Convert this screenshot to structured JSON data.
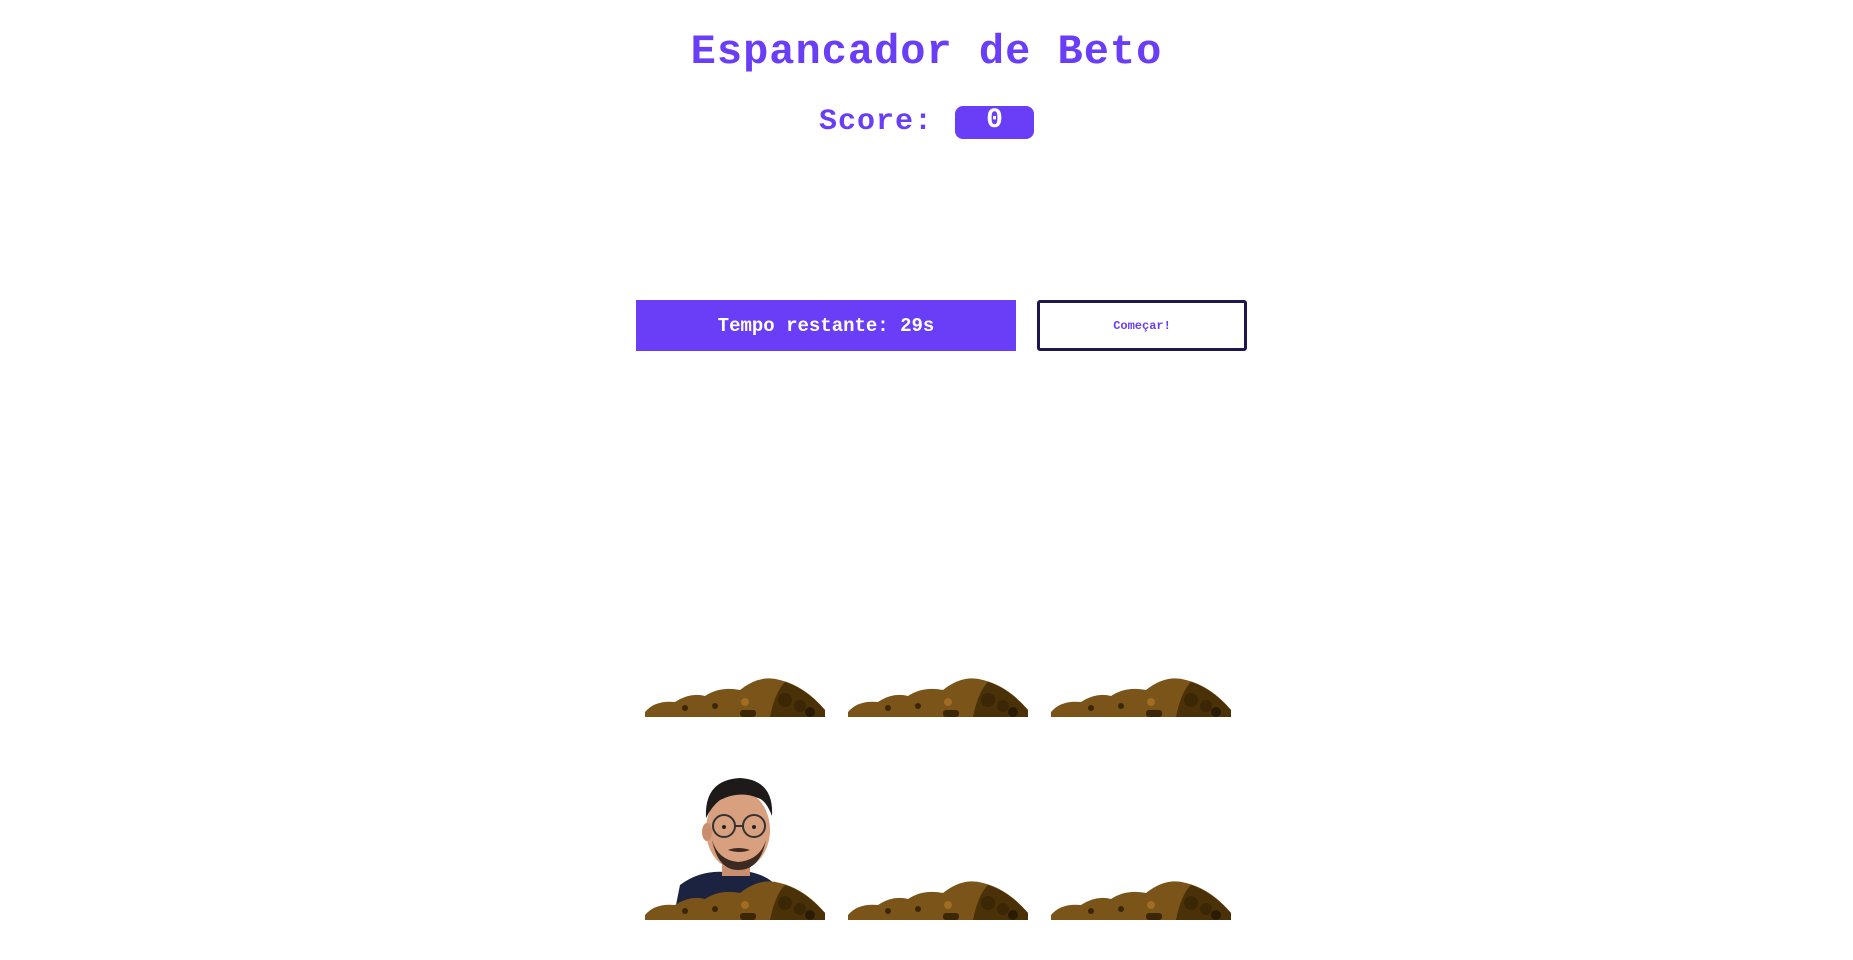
{
  "game": {
    "title": "Espancador de Beto",
    "score_label": "Score:",
    "score_value": "0",
    "timer_text": "Tempo restante: 29s",
    "start_label": "Começar!"
  },
  "board": {
    "holes": [
      {
        "id": "hole-1",
        "has_mole": false
      },
      {
        "id": "hole-2",
        "has_mole": false
      },
      {
        "id": "hole-3",
        "has_mole": false
      },
      {
        "id": "hole-4",
        "has_mole": true
      },
      {
        "id": "hole-5",
        "has_mole": false
      },
      {
        "id": "hole-6",
        "has_mole": false
      }
    ]
  },
  "colors": {
    "accent": "#6a3ef7",
    "button_border": "#1e1650",
    "dirt_light": "#7a5418",
    "dirt_dark": "#3b2706"
  }
}
